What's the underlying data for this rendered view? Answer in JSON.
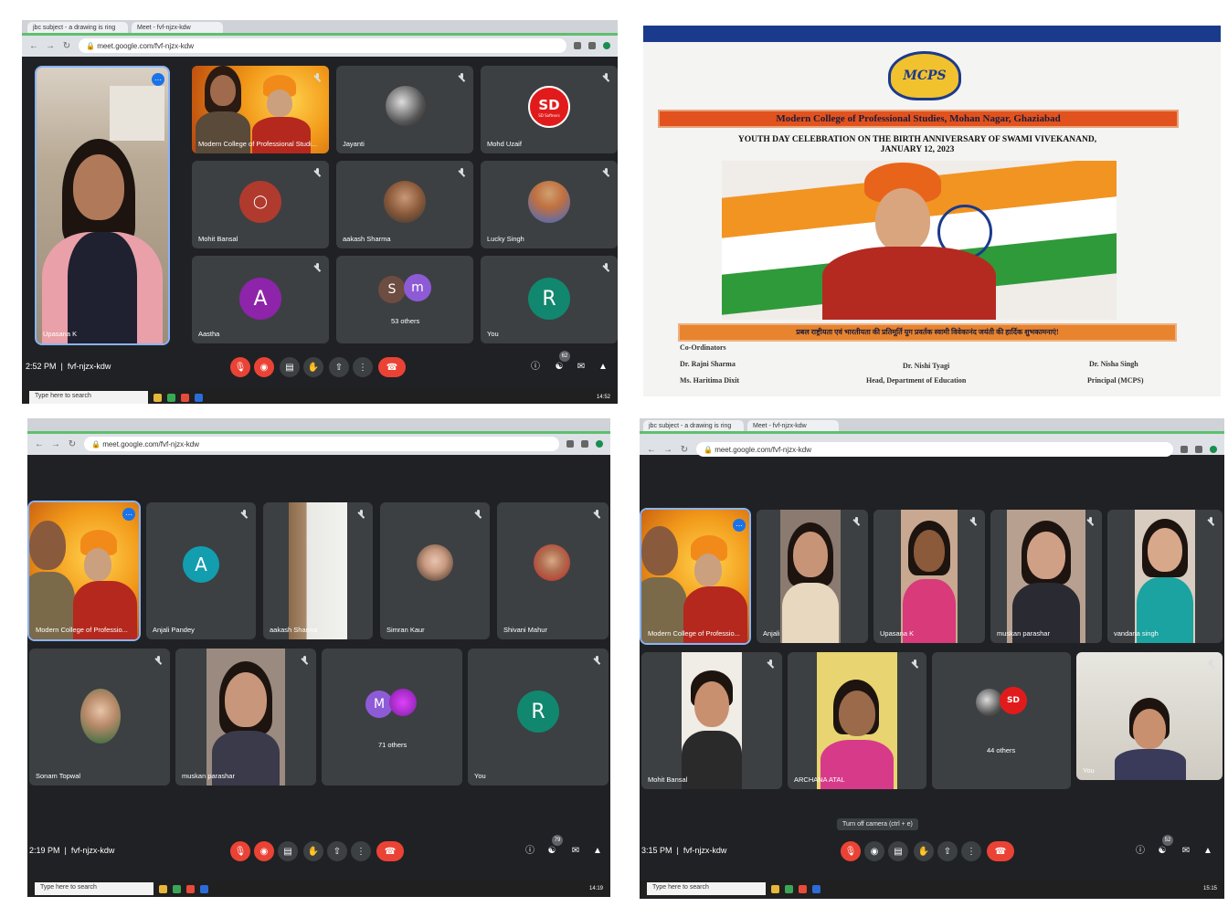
{
  "panel1": {
    "tabs": [
      "jbc subject - a drawing is ring",
      "Meet - fvf-njzx-kdw"
    ],
    "url": "meet.google.com/fvf-njzx-kdw",
    "participants": [
      {
        "name": "Upasana K",
        "type": "photo"
      },
      {
        "name": "Modern College of Professional Studi...",
        "type": "photo"
      },
      {
        "name": "Jayanti",
        "type": "photo"
      },
      {
        "name": "Mohd Uzaif",
        "type": "avatar",
        "initials": "SD",
        "sub": "SD Softners",
        "color": "#e11b1b"
      },
      {
        "name": "Mohit Bansal",
        "type": "camera-off"
      },
      {
        "name": "aakash Sharma",
        "type": "photo"
      },
      {
        "name": "Lucky Singh",
        "type": "photo"
      },
      {
        "name": "Aastha",
        "type": "avatar",
        "initials": "A",
        "color": "#8e24aa"
      },
      {
        "name": "53 others",
        "type": "group",
        "initials": [
          "S",
          "m"
        ]
      },
      {
        "name": "You",
        "type": "avatar",
        "initials": "R",
        "color": "#12876f"
      }
    ],
    "time": "2:52 PM",
    "meeting_code": "fvf-njzx-kdw",
    "people_count": "62",
    "taskbar_search": "Type here to search",
    "clock": "14:52"
  },
  "poster": {
    "logo_text": "MCPS",
    "banner_title": "Modern College of Professional Studies, Mohan Nagar, Ghaziabad",
    "subtitle_line1": "YOUTH DAY CELEBRATION ON THE BIRTH ANNIVERSARY OF SWAMI VIVEKANAND,",
    "subtitle_line2": "JANUARY 12, 2023",
    "hindi_banner": "प्रबल राष्ट्रीयता एवं भारतीयता की प्रतिमूर्ति युग प्रवर्तक स्वामी विवेकानंद जयंती की हार्दिक शुभकामनाएं!",
    "coordinators_label": "Co-Ordinators",
    "coordinator1": "Dr. Rajni Sharma",
    "coordinator2": "Ms. Haritima Dixit",
    "sign2_name": "Dr. Nishi Tyagi",
    "sign2_title": "Head, Department of Education",
    "sign3_name": "Dr. Nisha Singh",
    "sign3_title": "Principal (MCPS)"
  },
  "panel3": {
    "url": "meet.google.com/fvf-njzx-kdw",
    "participants": [
      {
        "name": "Modern College of Professio...",
        "type": "photo"
      },
      {
        "name": "Anjali Pandey",
        "type": "avatar",
        "initials": "A",
        "color": "#129eaf"
      },
      {
        "name": "aakash Sharma",
        "type": "photo"
      },
      {
        "name": "Simran Kaur",
        "type": "photo"
      },
      {
        "name": "Shivani Mahur",
        "type": "photo"
      },
      {
        "name": "Sonam Topwal",
        "type": "photo"
      },
      {
        "name": "muskan parashar",
        "type": "photo"
      },
      {
        "name": "71 others",
        "type": "group",
        "initials": [
          "M"
        ]
      },
      {
        "name": "You",
        "type": "avatar",
        "initials": "R",
        "color": "#12876f"
      }
    ],
    "time": "2:19 PM",
    "meeting_code": "fvf-njzx-kdw",
    "people_count": "79",
    "taskbar_search": "Type here to search",
    "clock": "14:19"
  },
  "panel4": {
    "tabs": [
      "jbc subject - a drawing is ring",
      "Meet - fvf-njzx-kdw"
    ],
    "url": "meet.google.com/fvf-njzx-kdw",
    "participants": [
      {
        "name": "Modern College of Professio...",
        "type": "photo"
      },
      {
        "name": "Anjali",
        "type": "photo"
      },
      {
        "name": "Upasana K",
        "type": "photo"
      },
      {
        "name": "muskan parashar",
        "type": "photo"
      },
      {
        "name": "vandana singh",
        "type": "photo"
      },
      {
        "name": "Mohit Bansal",
        "type": "photo"
      },
      {
        "name": "ARCHANA ATAL",
        "type": "photo"
      },
      {
        "name": "44 others",
        "type": "group"
      },
      {
        "name": "You",
        "type": "photo"
      }
    ],
    "tooltip": "Turn off camera (ctrl + e)",
    "time": "3:15 PM",
    "meeting_code": "fvf-njzx-kdw",
    "people_count": "52",
    "taskbar_search": "Type here to search",
    "clock": "15:15"
  },
  "colors": {
    "meet_bg": "#202124",
    "tile_bg": "#3c4043",
    "red": "#ea4335",
    "accent": "#8ab4f8"
  }
}
